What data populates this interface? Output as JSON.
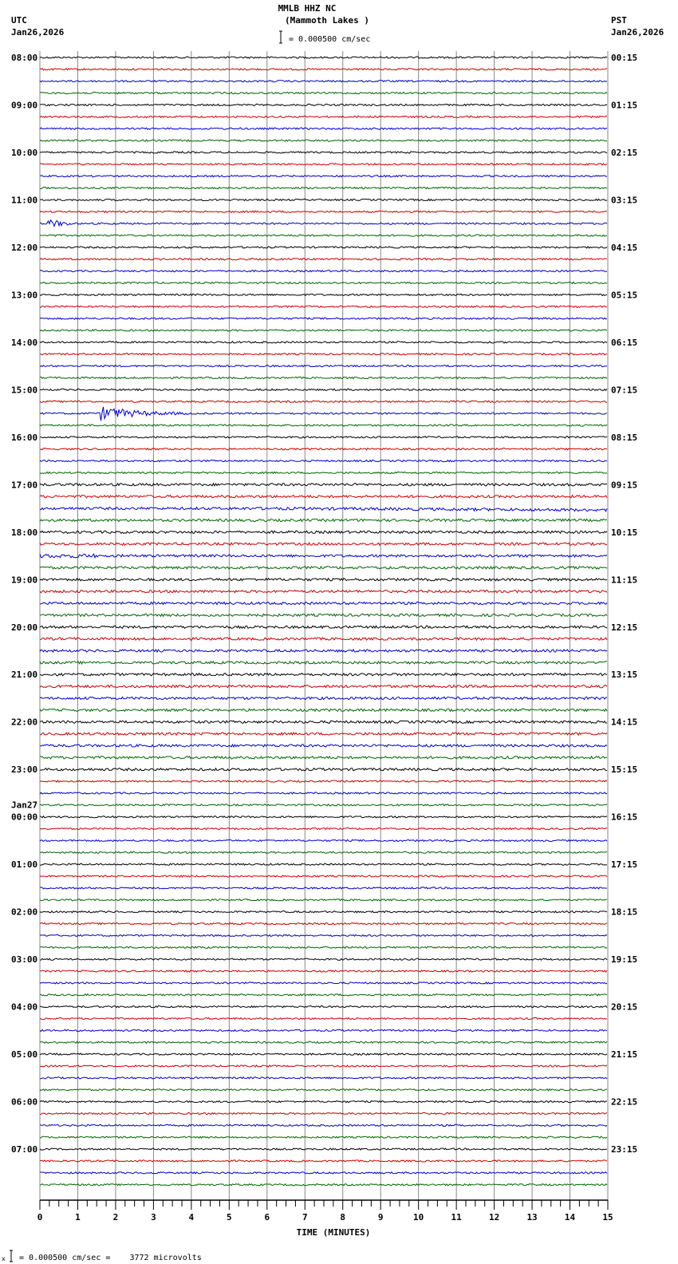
{
  "header": {
    "station": "MMLB HHZ NC",
    "location": "(Mammoth Lakes )",
    "scale_text": "= 0.000500 cm/sec",
    "left_tz": "UTC",
    "left_date": "Jan26,2026",
    "right_tz": "PST",
    "right_date": "Jan26,2026"
  },
  "footer": {
    "scale_text": "= 0.000500 cm/sec =    3772 microvolts",
    "marker": "x"
  },
  "chart_data": {
    "type": "line",
    "title": "MMLB HHZ NC (Mammoth Lakes )",
    "xlabel": "TIME (MINUTES)",
    "xlim": [
      0,
      15
    ],
    "x_ticks": [
      "0",
      "1",
      "2",
      "3",
      "4",
      "5",
      "6",
      "7",
      "8",
      "9",
      "10",
      "11",
      "12",
      "13",
      "14",
      "15"
    ],
    "traces_per_hour": 4,
    "trace_count": 96,
    "trace_colors": [
      "#000000",
      "#cc0000",
      "#0000cc",
      "#006600"
    ],
    "grid": true,
    "left_labels": [
      "08:00",
      "09:00",
      "10:00",
      "11:00",
      "12:00",
      "13:00",
      "14:00",
      "15:00",
      "16:00",
      "17:00",
      "18:00",
      "19:00",
      "20:00",
      "21:00",
      "22:00",
      "23:00",
      "00:00",
      "01:00",
      "02:00",
      "03:00",
      "04:00",
      "05:00",
      "06:00",
      "07:00"
    ],
    "date_change_label": "Jan27",
    "date_change_hour_index": 16,
    "right_labels": [
      "00:15",
      "01:15",
      "02:15",
      "03:15",
      "04:15",
      "05:15",
      "06:15",
      "07:15",
      "08:15",
      "09:15",
      "10:15",
      "11:15",
      "12:15",
      "13:15",
      "14:15",
      "15:15",
      "16:15",
      "17:15",
      "18:15",
      "19:15",
      "20:15",
      "21:15",
      "22:15",
      "23:15"
    ],
    "notable_events": [
      {
        "trace_start_utc": "11:30",
        "minutes": [
          0.2,
          1.0
        ],
        "amplitude": "moderate"
      },
      {
        "trace_start_utc": "15:30",
        "minutes": [
          1.6,
          4.0
        ],
        "amplitude": "large"
      },
      {
        "trace_start_utc": "17:30",
        "minutes": [
          5.0,
          15.0
        ],
        "amplitude": "drift"
      },
      {
        "trace_start_utc": "18:30",
        "minutes": [
          0.0,
          1.5
        ],
        "amplitude": "small"
      }
    ]
  }
}
